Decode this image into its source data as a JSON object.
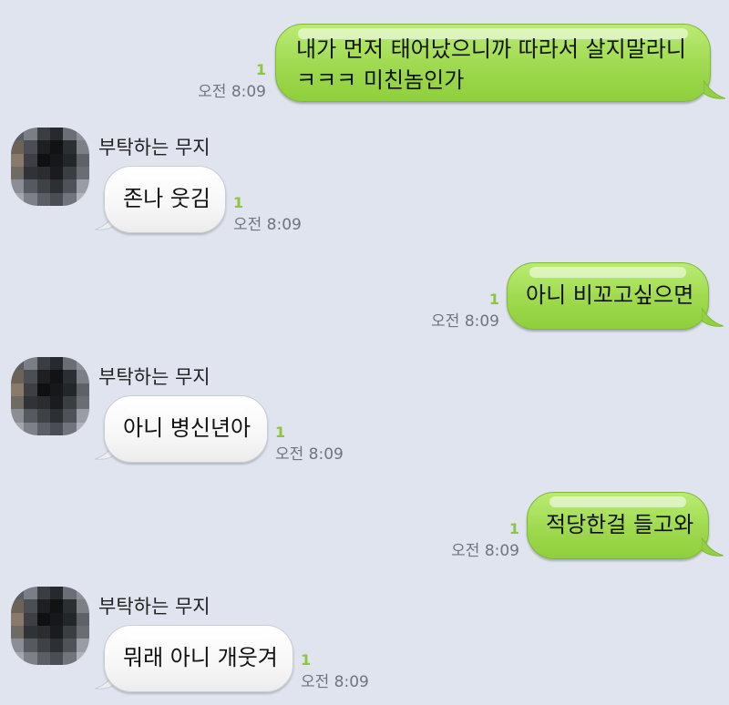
{
  "messages": [
    {
      "direction": "out",
      "lines": [
        "내가 먼저 태어났으니까 따라서 살지말라니",
        "ㅋㅋㅋ 미친놈인가"
      ],
      "unread": "1",
      "time": "오전 8:09"
    },
    {
      "direction": "in",
      "sender": "부탁하는 무지",
      "lines": [
        "존나 웃김"
      ],
      "unread": "1",
      "time": "오전 8:09"
    },
    {
      "direction": "out",
      "lines": [
        "아니 비꼬고싶으면"
      ],
      "unread": "1",
      "time": "오전 8:09"
    },
    {
      "direction": "in",
      "sender": "부탁하는 무지",
      "lines": [
        "아니 병신년아"
      ],
      "unread": "1",
      "time": "오전 8:09"
    },
    {
      "direction": "out",
      "lines": [
        "적당한걸 들고와"
      ],
      "unread": "1",
      "time": "오전 8:09"
    },
    {
      "direction": "in",
      "sender": "부탁하는 무지",
      "lines": [
        "뭐래 아니 개웃겨"
      ],
      "unread": "1",
      "time": "오전 8:09"
    }
  ],
  "colors": {
    "background": "#dfe4ee",
    "outgoing_bubble": "#a6dc55",
    "incoming_bubble": "#ffffff",
    "unread_count": "#8cc63f",
    "timestamp": "#6e7480"
  },
  "avatar_icon": "pixelated-profile-avatar"
}
